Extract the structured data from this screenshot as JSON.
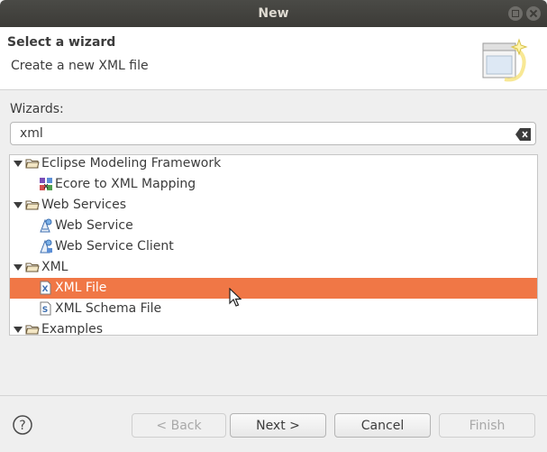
{
  "window": {
    "title": "New"
  },
  "header": {
    "title": "Select a wizard",
    "description": "Create a new XML file"
  },
  "wizards": {
    "label": "Wizards:",
    "filter_value": "xml"
  },
  "tree": {
    "items": [
      {
        "label": "Eclipse Modeling Framework",
        "kind": "folder",
        "expanded": true
      },
      {
        "label": "Ecore to XML Mapping",
        "kind": "ecore-mapping"
      },
      {
        "label": "Web Services",
        "kind": "folder",
        "expanded": true
      },
      {
        "label": "Web Service",
        "kind": "web-service"
      },
      {
        "label": "Web Service Client",
        "kind": "web-service-client"
      },
      {
        "label": "XML",
        "kind": "folder",
        "expanded": true
      },
      {
        "label": "XML File",
        "kind": "xml-file",
        "selected": true
      },
      {
        "label": "XML Schema File",
        "kind": "xml-schema"
      },
      {
        "label": "Examples",
        "kind": "folder",
        "expanded": true
      }
    ]
  },
  "buttons": {
    "back": "< Back",
    "next": "Next >",
    "cancel": "Cancel",
    "finish": "Finish"
  },
  "colors": {
    "selection": "#f07746",
    "titlebar": "#3c3b37"
  }
}
